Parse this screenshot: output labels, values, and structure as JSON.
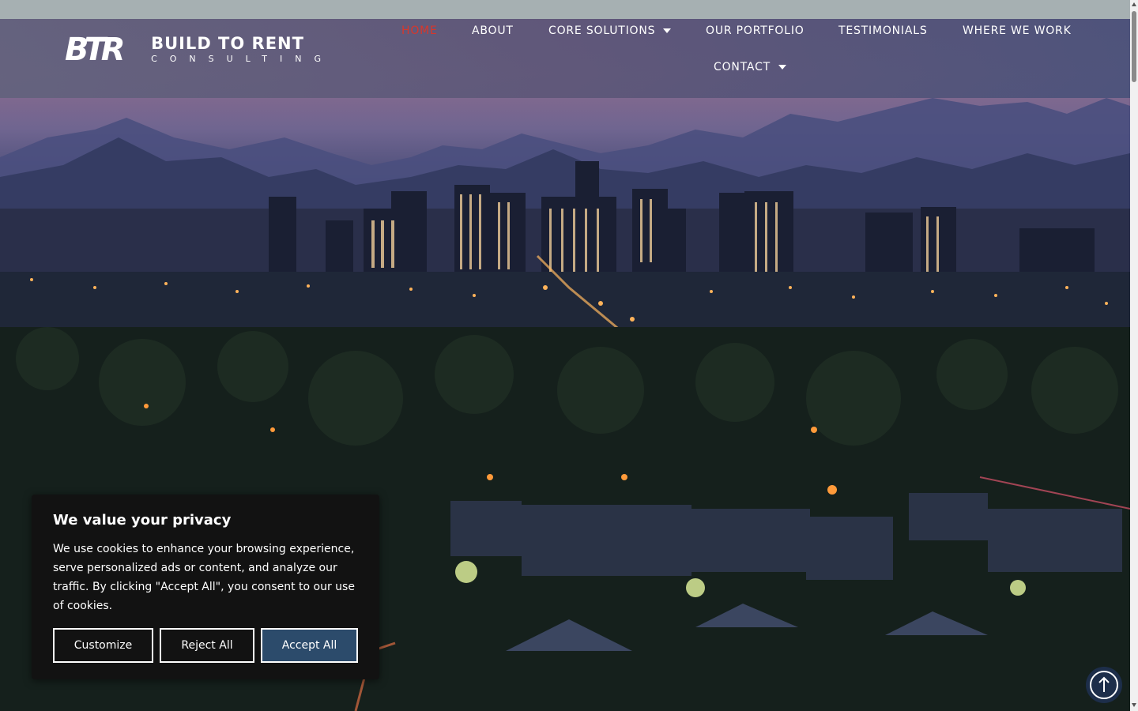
{
  "brand": {
    "mark": "BTR",
    "title": "BUILD TO RENT",
    "subtitle": "CONSULTING"
  },
  "nav": {
    "items": [
      {
        "label": "HOME",
        "active": true
      },
      {
        "label": "ABOUT"
      },
      {
        "label": "CORE SOLUTIONS",
        "dropdown": true
      },
      {
        "label": "OUR PORTFOLIO"
      },
      {
        "label": "TESTIMONIALS"
      },
      {
        "label": "WHERE WE WORK"
      },
      {
        "label": "CONTACT",
        "dropdown": true
      }
    ],
    "active_color": "#d8372b"
  },
  "cookie_banner": {
    "title": "We value your privacy",
    "body": "We use cookies to enhance your browsing experience, serve personalized ads or content, and analyze our traffic. By clicking \"Accept All\", you consent to our use of cookies.",
    "customize_label": "Customize",
    "reject_label": "Reject All",
    "accept_label": "Accept All",
    "accept_color": "#2c4b6b"
  },
  "icons": {
    "scroll_top": "arrow-up-circle-icon",
    "dropdown": "caret-down-icon"
  }
}
